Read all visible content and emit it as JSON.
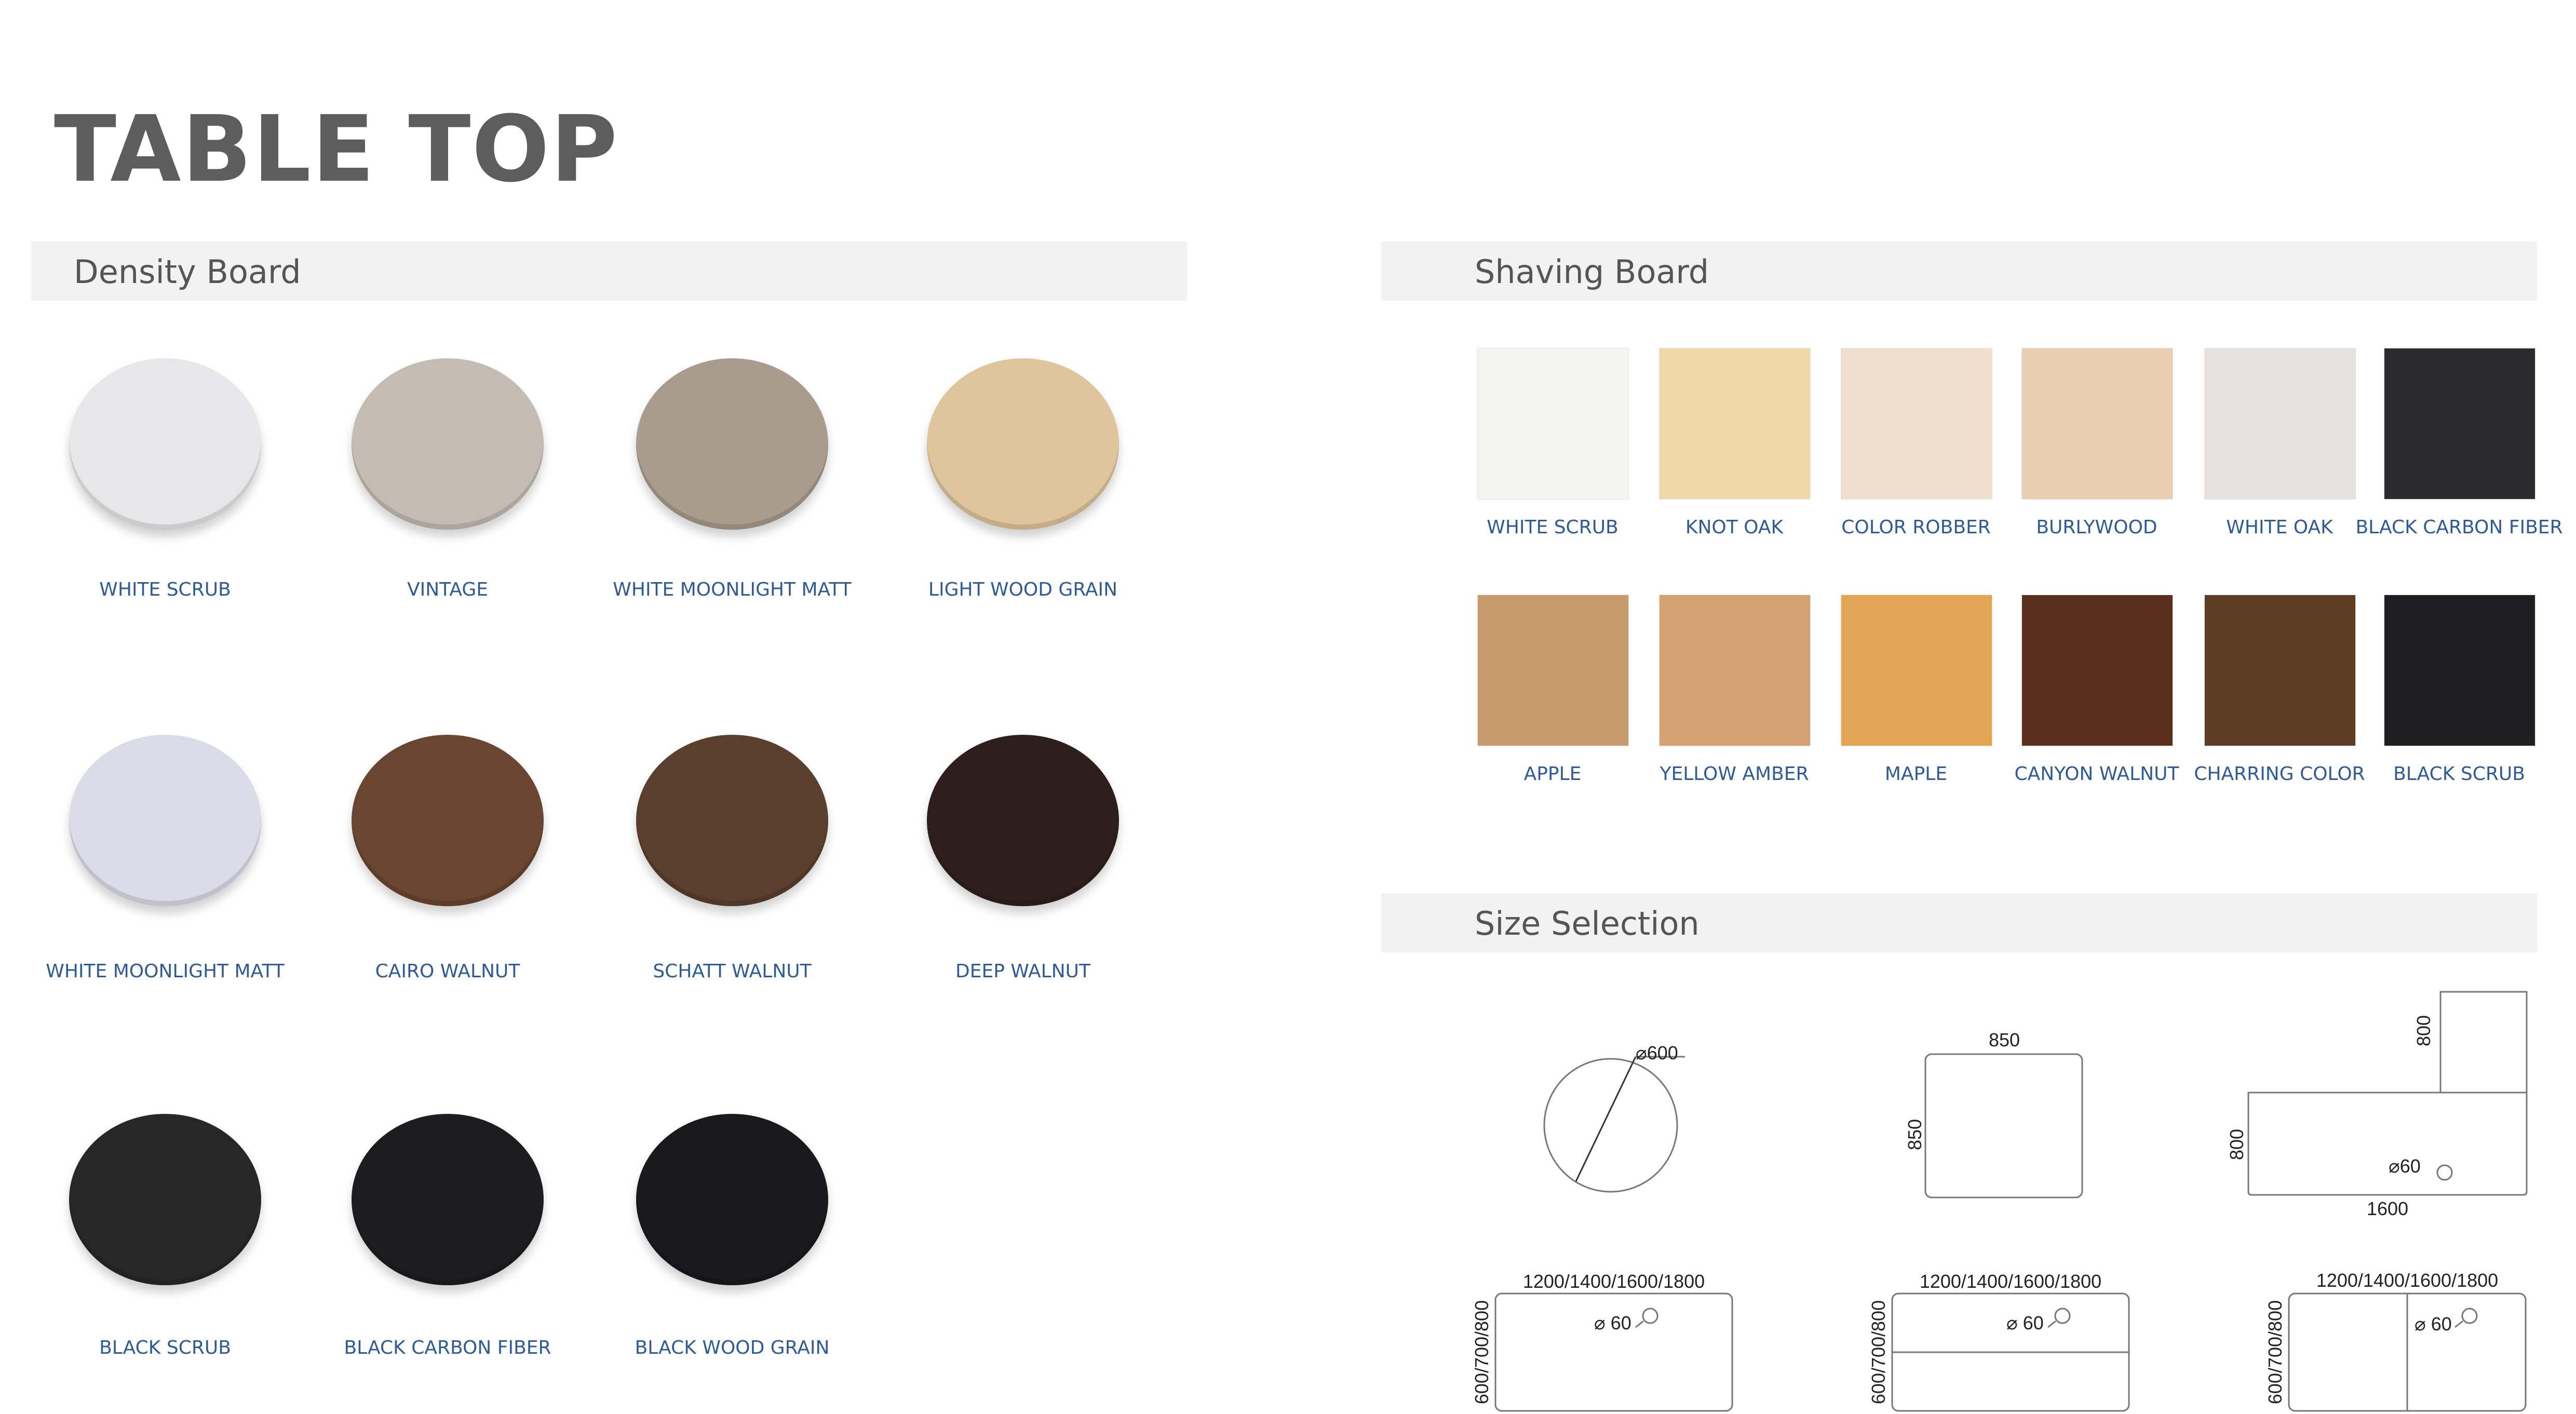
{
  "page_title": "TABLE TOP",
  "density": {
    "heading": "Density Board",
    "items": [
      {
        "label": "WHITE SCRUB",
        "color": "#e7e7e9"
      },
      {
        "label": "VINTAGE",
        "color": "#c4bcb3"
      },
      {
        "label": "WHITE MOONLIGHT MATT",
        "color": "#a99b8d"
      },
      {
        "label": "LIGHT WOOD GRAIN",
        "color": "#dfc59b"
      },
      {
        "label": "WHITE MOONLIGHT MATT",
        "color": "#dcdbe8"
      },
      {
        "label": "CAIRO WALNUT",
        "color": "#6a4530"
      },
      {
        "label": "SCHATT WALNUT",
        "color": "#5a3f2e"
      },
      {
        "label": "DEEP WALNUT",
        "color": "#2e1f1c"
      },
      {
        "label": "BLACK SCRUB",
        "color": "#272727"
      },
      {
        "label": "BLACK CARBON FIBER",
        "color": "#1d1d1f"
      },
      {
        "label": "BLACK WOOD GRAIN",
        "color": "#1a1a1c"
      }
    ]
  },
  "shaving": {
    "heading": "Shaving Board",
    "items": [
      {
        "label": "WHITE SCRUB",
        "color": "#f3f3f2"
      },
      {
        "label": "KNOT OAK",
        "color": "#f2d8a8"
      },
      {
        "label": "COLOR ROBBER",
        "color": "#f1dfcd"
      },
      {
        "label": "BURLYWOOD",
        "color": "#e8cdb0"
      },
      {
        "label": "WHITE OAK",
        "color": "#e8e1e0"
      },
      {
        "label": "BLACK CARBON FIBER",
        "color": "#2b2b2e"
      },
      {
        "label": "APPLE",
        "color": "#c89b6c"
      },
      {
        "label": "YELLOW AMBER",
        "color": "#d3a172"
      },
      {
        "label": "MAPLE",
        "color": "#e1a553"
      },
      {
        "label": "CANYON WALNUT",
        "color": "#5a2f1c"
      },
      {
        "label": "CHARRING COLOR",
        "color": "#5e3d25"
      },
      {
        "label": "BLACK SCRUB",
        "color": "#1f1f22"
      }
    ]
  },
  "size": {
    "heading": "Size Selection",
    "round": {
      "diameter": "600"
    },
    "square": {
      "width": "850",
      "height": "850"
    },
    "l_shape": {
      "top": "800",
      "side": "800",
      "bottom": "1600",
      "hole": "60"
    },
    "rect1": {
      "width": "1200/1400/1600/1800",
      "depth": "600/700/800",
      "hole": "60"
    },
    "rect2": {
      "width": "1200/1400/1600/1800",
      "depth": "600/700/800",
      "hole": "60"
    },
    "rect3": {
      "width": "1200/1400/1600/1800",
      "depth": "600/700/800",
      "hole": "60"
    }
  }
}
